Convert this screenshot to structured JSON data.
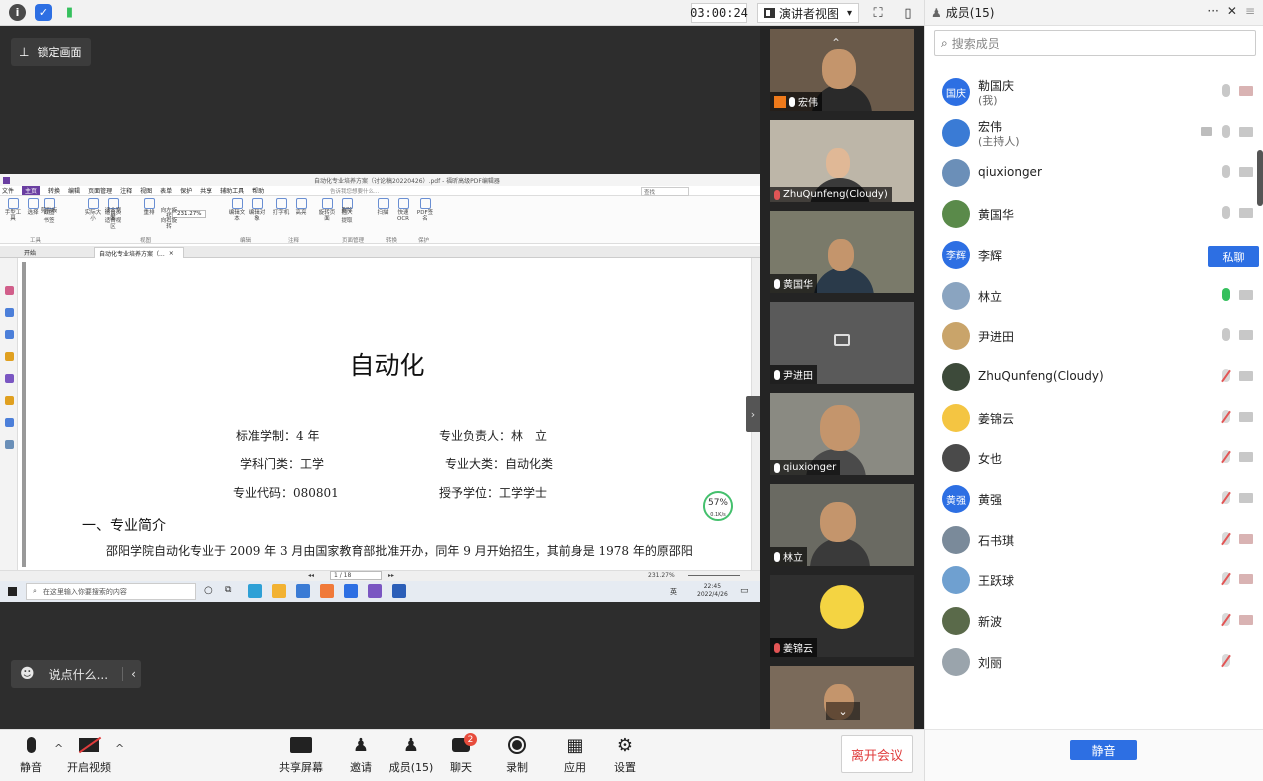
{
  "topbar": {
    "timer": "03:00:24",
    "view_mode": "演讲者视图",
    "view_caret": "▾"
  },
  "share": {
    "lock_label": "锁定画面",
    "chat_placeholder": "说点什么..."
  },
  "pdf": {
    "window_title": "自动化专业培养方案（讨论稿20220426）.pdf - 福昕高级PDF编辑器",
    "menu": [
      "文件",
      "主页",
      "转换",
      "编辑",
      "页面管理",
      "注释",
      "视图",
      "表单",
      "保护",
      "共享",
      "辅助工具",
      "帮助"
    ],
    "menu_active_index": 1,
    "search_hint": "告诉我您想要什么...",
    "search_box": "查找",
    "zoom_in_ribbon": "231.27%",
    "ribbon": [
      "手型工具",
      "选择",
      "截图",
      "剪贴板",
      "书签",
      "实际大小",
      "适合页面",
      "适合宽度",
      "适合视区",
      "重排",
      "向左旋转",
      "向右旋转",
      "编辑文本",
      "编辑对象",
      "打字机",
      "高亮",
      "旋转页面",
      "插入",
      "删除",
      "提取",
      "扫描",
      "快速OCR",
      "PDF签名"
    ],
    "ribbon_groups": [
      "工具",
      "视图",
      "编辑",
      "注释",
      "页面管理",
      "转换",
      "保护"
    ],
    "tabs": [
      "开始",
      "自动化专业培养方案（..."
    ],
    "doc_title": "自动化",
    "fields": {
      "duration": "标准学制：4 年",
      "leader": "专业负责人：林　立",
      "discipline": "学科门类：工学",
      "category": "专业大类：自动化类",
      "code": "专业代码：080801",
      "degree": "授予学位：工学学士"
    },
    "section": "一、专业简介",
    "paragraph": "邵阳学院自动化专业于 2009 年 3 月由国家教育部批准开办，同年 9 月开始招生，其前身是 1978 年的原邵阳",
    "page_indicator": "1 / 18",
    "zoom": "231.27%",
    "net_percent": "57%",
    "net_speed": "0.1K/s",
    "taskbar_search": "在这里输入你要搜索的内容",
    "clock_time": "22:45",
    "clock_date": "2022/4/26",
    "ime": "英"
  },
  "video_tiles": [
    {
      "name": "宏伟",
      "muted": false,
      "host": true
    },
    {
      "name": "ZhuQunfeng(Cloudy)",
      "muted": true
    },
    {
      "name": "黄国华",
      "muted": false
    },
    {
      "name": "尹进田",
      "muted": false,
      "camera_off": true
    },
    {
      "name": "qiuxionger",
      "muted": false
    },
    {
      "name": "林立",
      "muted": false
    },
    {
      "name": "姜锦云",
      "muted": true
    },
    {
      "name": "",
      "muted": false
    }
  ],
  "toolbar": {
    "mute": "静音",
    "start_video": "开启视频",
    "share_screen": "共享屏幕",
    "invite": "邀请",
    "members": "成员(15)",
    "chat": "聊天",
    "chat_badge": "2",
    "record": "录制",
    "apps": "应用",
    "settings": "设置",
    "leave": "离开会议"
  },
  "members_panel": {
    "title": "成员(15)",
    "search_placeholder": "搜索成员",
    "private_chat": "私聊",
    "mute_all": "静音",
    "members": [
      {
        "name": "勒国庆",
        "role": "(我)",
        "avatar_text": "国庆",
        "avatar_color": "#2d6fe3",
        "mic": "idle",
        "cam": "off"
      },
      {
        "name": "宏伟",
        "role": "(主持人)",
        "avatar_text": "",
        "avatar_color": "#3a7bd5",
        "mic": "idle",
        "cam": "on",
        "sharing": true
      },
      {
        "name": "qiuxionger",
        "role": "",
        "avatar_text": "",
        "avatar_color": "#6b8fb8",
        "mic": "idle",
        "cam": "on"
      },
      {
        "name": "黄国华",
        "role": "",
        "avatar_text": "",
        "avatar_color": "#5a8a4a",
        "mic": "idle",
        "cam": "on"
      },
      {
        "name": "李辉",
        "role": "",
        "avatar_text": "李辉",
        "avatar_color": "#2d6fe3",
        "mic": "none",
        "cam": "none"
      },
      {
        "name": "林立",
        "role": "",
        "avatar_text": "",
        "avatar_color": "#8aa4c0",
        "mic": "on",
        "cam": "on"
      },
      {
        "name": "尹进田",
        "role": "",
        "avatar_text": "",
        "avatar_color": "#c9a46a",
        "mic": "idle",
        "cam": "on"
      },
      {
        "name": "ZhuQunfeng(Cloudy)",
        "role": "",
        "avatar_text": "",
        "avatar_color": "#3d4a3a",
        "mic": "muted",
        "cam": "on"
      },
      {
        "name": "姜锦云",
        "role": "",
        "avatar_text": "",
        "avatar_color": "#f4c542",
        "mic": "muted",
        "cam": "on"
      },
      {
        "name": "女也",
        "role": "",
        "avatar_text": "",
        "avatar_color": "#4a4a4a",
        "mic": "muted",
        "cam": "on"
      },
      {
        "name": "黄强",
        "role": "",
        "avatar_text": "黄强",
        "avatar_color": "#2d6fe3",
        "mic": "muted",
        "cam": "on"
      },
      {
        "name": "石书琪",
        "role": "",
        "avatar_text": "",
        "avatar_color": "#7a8a9a",
        "mic": "muted",
        "cam": "off"
      },
      {
        "name": "王跃球",
        "role": "",
        "avatar_text": "",
        "avatar_color": "#6fa0d0",
        "mic": "muted",
        "cam": "off"
      },
      {
        "name": "新波",
        "role": "",
        "avatar_text": "",
        "avatar_color": "#5a6a4a",
        "mic": "muted",
        "cam": "off"
      },
      {
        "name": "刘丽",
        "role": "",
        "avatar_text": "",
        "avatar_color": "#9aa4ac",
        "mic": "muted",
        "cam": "none"
      }
    ]
  }
}
